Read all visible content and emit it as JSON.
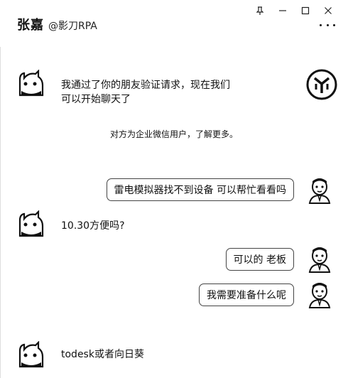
{
  "window": {
    "controls": [
      {
        "name": "pin",
        "icon": "pin-icon"
      },
      {
        "name": "minimize",
        "icon": "minimize-icon"
      },
      {
        "name": "maximize",
        "icon": "maximize-icon"
      },
      {
        "name": "close",
        "icon": "close-icon"
      }
    ]
  },
  "header": {
    "name": "张嘉",
    "org": "@影刀RPA",
    "more_icon": "more-icon"
  },
  "messages": [
    {
      "side": "in",
      "lines": [
        "我通过了你的朋友验证请求，现在我们",
        "可以开始聊天了"
      ]
    },
    {
      "side": "system",
      "text": "对方为企业微信用户，了解更多。"
    },
    {
      "side": "out",
      "text": "雷电模拟器找不到设备 可以帮忙看看吗"
    },
    {
      "side": "in",
      "text": "10.30方便吗?"
    },
    {
      "side": "out",
      "text": "可以的 老板"
    },
    {
      "side": "out",
      "text": "我需要准备什么呢"
    },
    {
      "side": "in",
      "text": "todesk或者向日葵"
    }
  ],
  "colors": {
    "bubble_border": "#444444",
    "background": "#ffffff",
    "text": "#111111"
  }
}
